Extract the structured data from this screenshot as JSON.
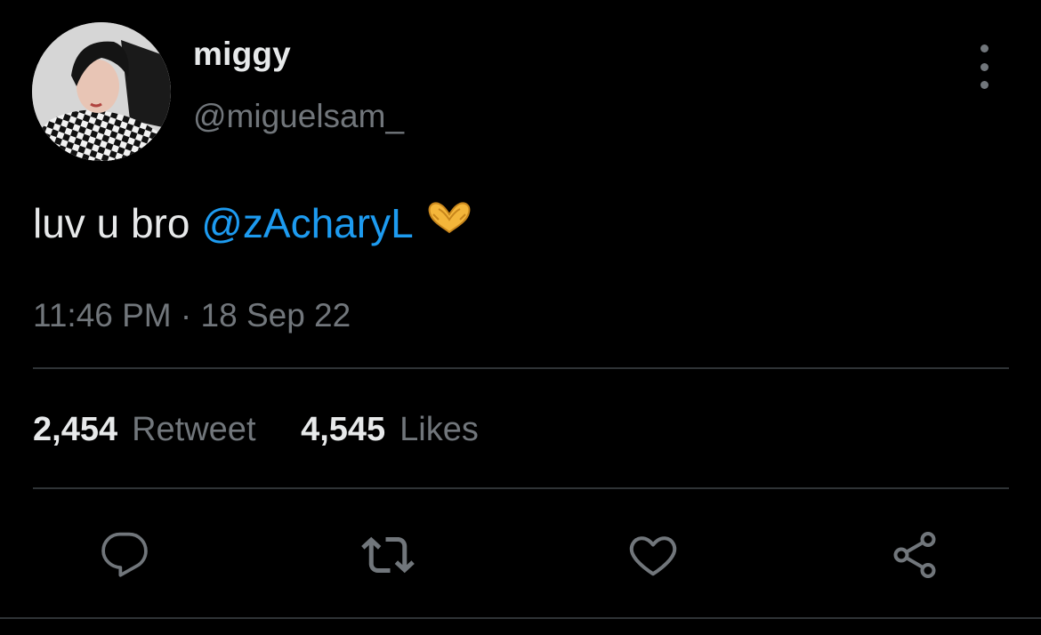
{
  "author": {
    "display_name": "miggy",
    "handle": "@miguelsam_"
  },
  "tweet": {
    "text_prefix": "luv u bro ",
    "mention": "@zAcharyL",
    "emoji": "heart-hands",
    "timestamp": "11:46 PM · 18 Sep 22"
  },
  "stats": {
    "retweets_count": "2,454",
    "retweets_label": "Retweet",
    "likes_count": "4,545",
    "likes_label": "Likes"
  },
  "actions": {
    "reply": "reply-icon",
    "retweet": "retweet-icon",
    "like": "heart-icon",
    "share": "share-icon"
  },
  "colors": {
    "background": "#000000",
    "text_primary": "#e7e9ea",
    "text_secondary": "#71767b",
    "accent": "#1d9bf0",
    "divider": "#2f3336"
  }
}
